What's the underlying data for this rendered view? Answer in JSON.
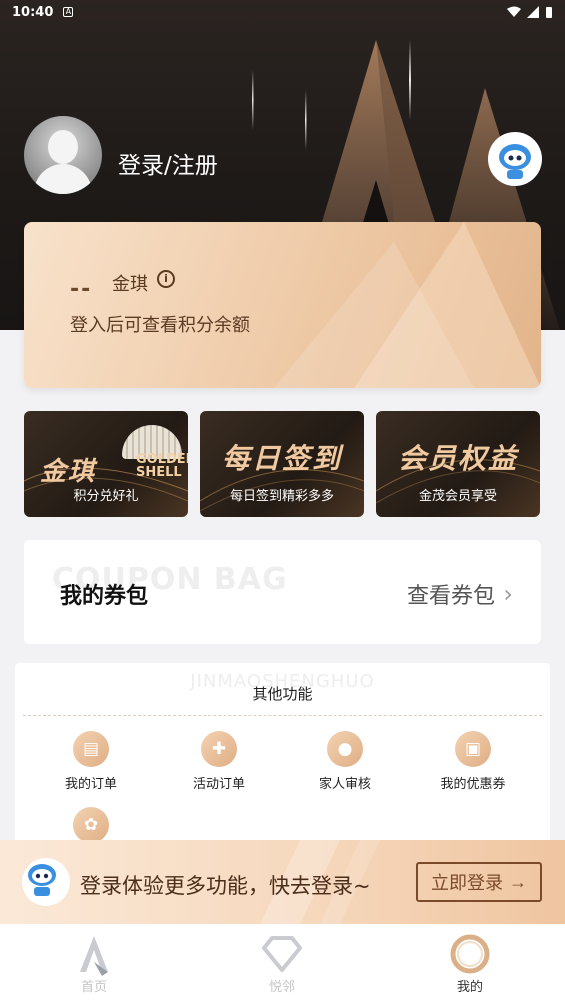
{
  "status_bar": {
    "time": "10:40",
    "notification_icon": "a-icon"
  },
  "profile": {
    "login_title": "登录/注册"
  },
  "points_card": {
    "value_placeholder": "--",
    "label": "金琪",
    "tip": "登入后可查看积分余额"
  },
  "feature_tiles": [
    {
      "title": "金琪",
      "logo_line1": "GOLDEN",
      "logo_line2": "SHELL",
      "subtitle": "积分兑好礼"
    },
    {
      "title": "每日签到",
      "subtitle": "每日签到精彩多多"
    },
    {
      "title": "会员权益",
      "subtitle": "金茂会员享受"
    }
  ],
  "coupon": {
    "bg_text": "COUPON BAG",
    "title": "我的券包",
    "link": "查看券包"
  },
  "functions": {
    "bg_text": "JINMAOSHENGHUO",
    "title": "其他功能",
    "items": [
      {
        "label": "我的订单",
        "icon": "order-icon"
      },
      {
        "label": "活动订单",
        "icon": "activity-icon"
      },
      {
        "label": "家人审核",
        "icon": "family-icon"
      },
      {
        "label": "我的优惠券",
        "icon": "coupon-icon"
      }
    ],
    "more_icon": "settings-icon"
  },
  "login_banner": {
    "text": "登录体验更多功能，快去登录~",
    "button": "立即登录"
  },
  "bottom_nav": [
    {
      "label": "首页",
      "icon": "home-icon",
      "active": false
    },
    {
      "label": "悦邻",
      "icon": "diamond-icon",
      "active": false
    },
    {
      "label": "我的",
      "icon": "ring-icon",
      "active": true
    }
  ],
  "colors": {
    "accent_gold": "#e2b48a",
    "dark_brown": "#5a3b22",
    "hero_dark": "#1e1a18"
  }
}
